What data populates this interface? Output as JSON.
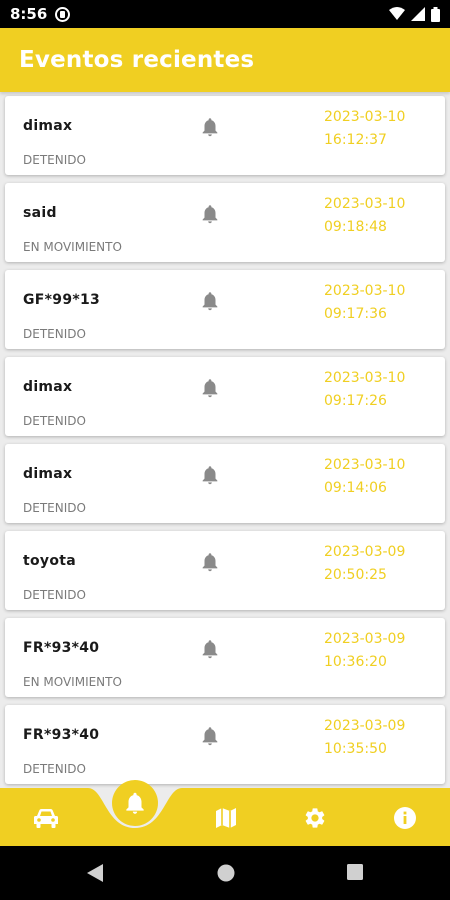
{
  "status_bar": {
    "time": "8:56"
  },
  "header": {
    "title": "Eventos recientes"
  },
  "events": [
    {
      "name": "dimax",
      "status": "DETENIDO",
      "date": "2023-03-10",
      "time": "16:12:37"
    },
    {
      "name": "said",
      "status": "EN MOVIMIENTO",
      "date": "2023-03-10",
      "time": "09:18:48"
    },
    {
      "name": "GF*99*13",
      "status": "DETENIDO",
      "date": "2023-03-10",
      "time": "09:17:36"
    },
    {
      "name": "dimax",
      "status": "DETENIDO",
      "date": "2023-03-10",
      "time": "09:17:26"
    },
    {
      "name": "dimax",
      "status": "DETENIDO",
      "date": "2023-03-10",
      "time": "09:14:06"
    },
    {
      "name": "toyota",
      "status": "DETENIDO",
      "date": "2023-03-09",
      "time": "20:50:25"
    },
    {
      "name": "FR*93*40",
      "status": "EN MOVIMIENTO",
      "date": "2023-03-09",
      "time": "10:36:20"
    },
    {
      "name": "FR*93*40",
      "status": "DETENIDO",
      "date": "2023-03-09",
      "time": "10:35:50"
    }
  ],
  "bottom_nav": {
    "items": [
      {
        "icon": "car-icon",
        "active": false
      },
      {
        "icon": "bell-icon",
        "active": true
      },
      {
        "icon": "map-icon",
        "active": false
      },
      {
        "icon": "gear-icon",
        "active": false
      },
      {
        "icon": "info-icon",
        "active": false
      }
    ]
  },
  "colors": {
    "accent": "#f0cf22",
    "bell_gray": "#8a8a8a"
  }
}
